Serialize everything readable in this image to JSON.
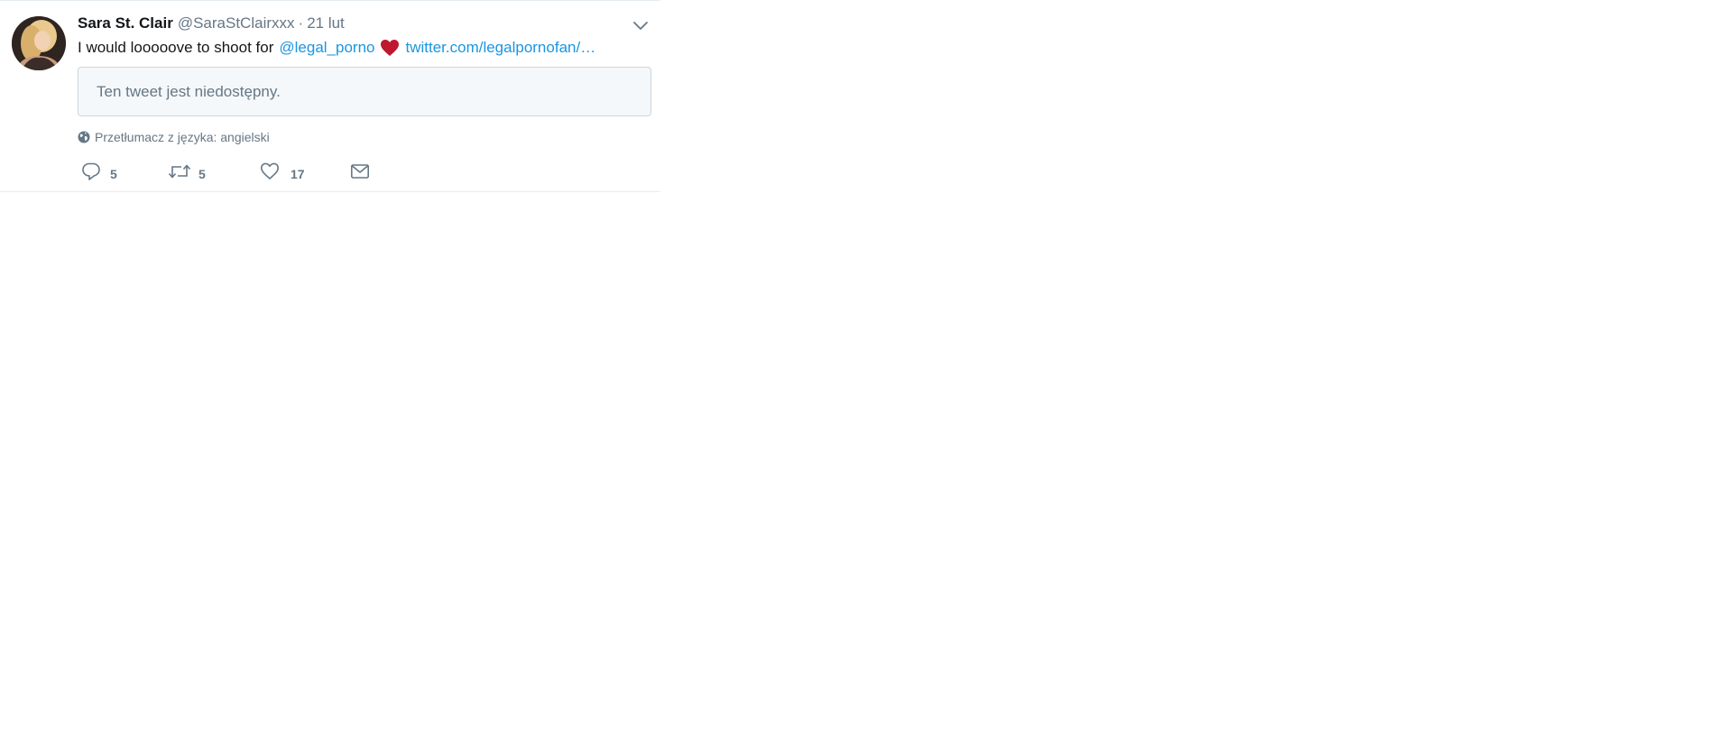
{
  "tweet": {
    "display_name": "Sara St. Clair",
    "handle": "@SaraStClairxxx",
    "separator": "·",
    "timestamp": "21 lut",
    "text_prefix": "I would looooove to shoot for",
    "mention": "@legal_porno",
    "emoji": "red-heart",
    "link": "twitter.com/legalpornofan/…",
    "quote_unavailable": "Ten tweet jest niedostępny.",
    "translate_label": "Przetłumacz z języka: angielski"
  },
  "actions": {
    "reply_count": "5",
    "retweet_count": "5",
    "like_count": "17"
  },
  "icons": {
    "reply": "reply-icon",
    "retweet": "retweet-icon",
    "like": "heart-icon",
    "dm": "envelope-icon",
    "translate": "globe-icon",
    "menu": "chevron-down-icon"
  },
  "colors": {
    "link": "#1b95e0",
    "muted": "#657786",
    "border": "#e6ecf0",
    "quote_bg": "#f5f8fa",
    "heart_emoji": "#be1931"
  }
}
